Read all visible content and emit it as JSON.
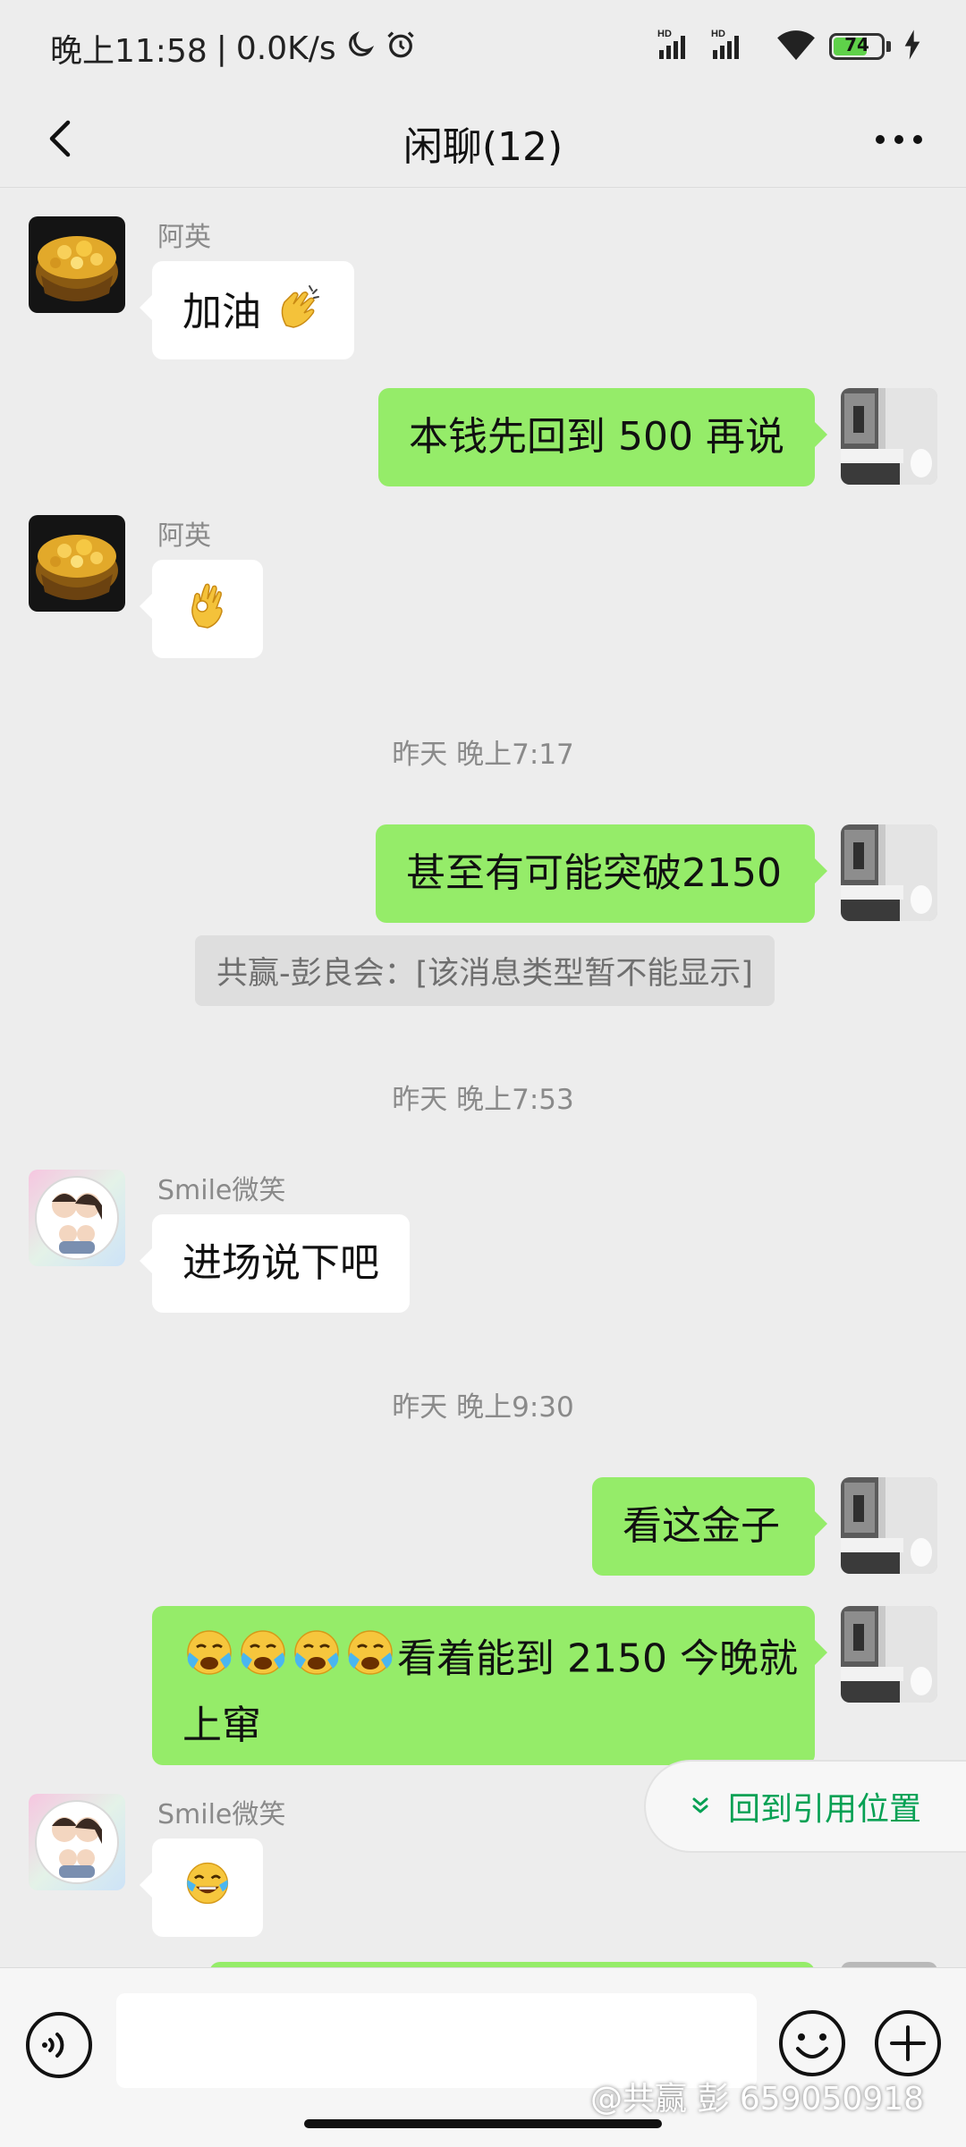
{
  "status_bar": {
    "time": "晚上11:58",
    "network_speed": "0.0K/s",
    "battery": "74",
    "battery_level": 0.74,
    "icons": [
      "moon-icon",
      "alarm-icon",
      "signal-hd-icon",
      "wifi-icon",
      "battery-icon",
      "charging-icon"
    ]
  },
  "header": {
    "title": "闲聊(12)",
    "back_icon": "chevron-left-icon",
    "more_icon": "more-dots-icon"
  },
  "messages": [
    {
      "sender": "阿英",
      "text": "加油",
      "emoji": "clapping-hands"
    },
    {
      "text": "本钱先回到 500 再说"
    },
    {
      "sender": "阿英",
      "emoji": "ok-hand"
    },
    {
      "timestamp": "昨天 晚上7:17"
    },
    {
      "text": "甚至有可能突破2150"
    },
    {
      "system": "共赢-彭良会：[该消息类型暂不能显示]"
    },
    {
      "timestamp": "昨天 晚上7:53"
    },
    {
      "sender": "Smile微笑",
      "text": "进场说下吧"
    },
    {
      "timestamp": "昨天 晚上9:30"
    },
    {
      "text": "看这金子"
    },
    {
      "text_line1": "看着能到 2150 今晚就",
      "text_line2": "上窜",
      "emoji": "loudly-crying-face x4"
    },
    {
      "sender": "Smile微笑",
      "emoji": "tears-of-joy"
    }
  ],
  "jump_button": {
    "label": "回到引用位置",
    "icon": "double-chevron-down-icon",
    "color": "#07a154"
  },
  "input_bar": {
    "placeholder": "",
    "voice_icon": "voice-icon",
    "emoji_icon": "emoji-icon",
    "plus_icon": "plus-icon"
  },
  "watermark": "@共赢 彭 659050918",
  "colors": {
    "background": "#ededed",
    "outgoing_bubble": "#95ec69",
    "incoming_bubble": "#ffffff"
  }
}
